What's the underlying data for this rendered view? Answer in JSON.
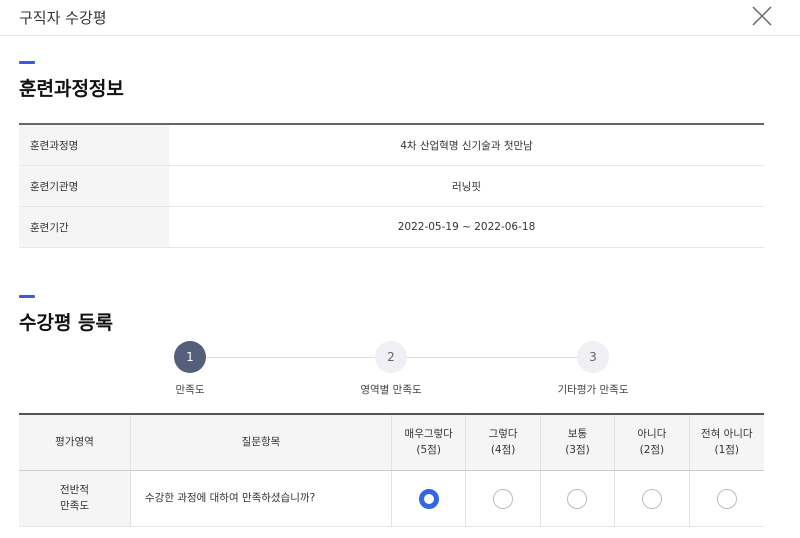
{
  "modal": {
    "title": "구직자 수강평",
    "close_icon": "close-icon"
  },
  "course_info": {
    "heading": "훈련과정정보",
    "rows": [
      {
        "label": "훈련과정명",
        "value": "4차 산업혁명 신기술과 첫만남"
      },
      {
        "label": "훈련기관명",
        "value": "러닝핏"
      },
      {
        "label": "훈련기간",
        "value": "2022-05-19 ~ 2022-06-18"
      }
    ]
  },
  "review": {
    "heading": "수강평 등록",
    "steps": [
      {
        "number": "1",
        "label": "만족도",
        "active": true
      },
      {
        "number": "2",
        "label": "영역별 만족도",
        "active": false
      },
      {
        "number": "3",
        "label": "기타평가 만족도",
        "active": false
      }
    ],
    "table": {
      "headers": {
        "area": "평가영역",
        "question": "질문항목",
        "options": [
          {
            "line1": "매우그렇다",
            "line2": "(5점)"
          },
          {
            "line1": "그렇다",
            "line2": "(4점)"
          },
          {
            "line1": "보통",
            "line2": "(3점)"
          },
          {
            "line1": "아니다",
            "line2": "(2점)"
          },
          {
            "line1": "전혀 아니다",
            "line2": "(1점)"
          }
        ]
      },
      "rows": [
        {
          "area_line1": "전반적",
          "area_line2": "만족도",
          "question": "수강한 과정에 대하여 만족하셨습니까?",
          "selected_index": 0
        }
      ]
    }
  },
  "colors": {
    "accent": "#3b5bdb",
    "radio_selected": "#3366e6",
    "step_active": "#555e7a"
  }
}
